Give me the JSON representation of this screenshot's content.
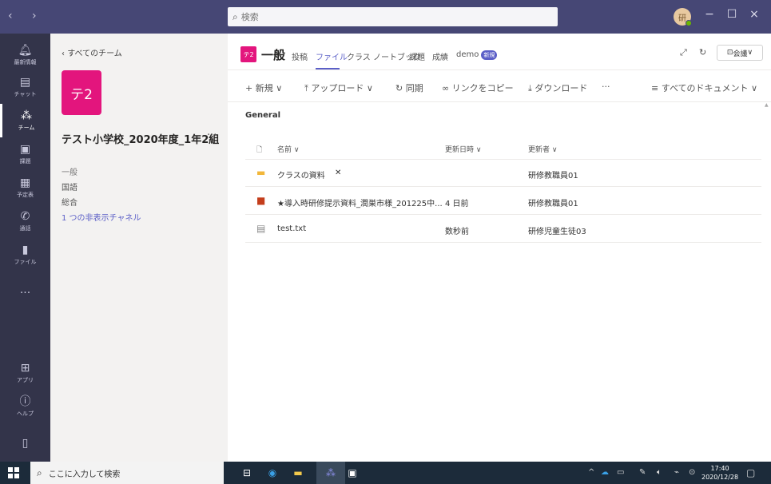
{
  "titlebar": {
    "search_placeholder": "検索",
    "avatar_initial": "研",
    "minimize": "−",
    "maximize": "☐",
    "close": "×"
  },
  "appbar": {
    "items": [
      {
        "label": "最新情報",
        "icon": "bell-icon"
      },
      {
        "label": "チャット",
        "icon": "chat-icon"
      },
      {
        "label": "チーム",
        "icon": "teams-icon"
      },
      {
        "label": "課題",
        "icon": "assignments-icon"
      },
      {
        "label": "予定表",
        "icon": "calendar-icon"
      },
      {
        "label": "通話",
        "icon": "phone-icon"
      },
      {
        "label": "ファイル",
        "icon": "file-icon"
      },
      {
        "label": "",
        "icon": "more-icon"
      },
      {
        "label": "アプリ",
        "icon": "apps-icon"
      },
      {
        "label": "ヘルプ",
        "icon": "help-icon"
      }
    ]
  },
  "teampanel": {
    "back_label": "すべてのチーム",
    "team_avatar": "テ2",
    "team_name": "テスト小学校_2020年度_1年2組",
    "more": "···",
    "channels": [
      "一般",
      "国語",
      "総合"
    ],
    "hidden_channels": "1 つの非表示チャネル"
  },
  "header": {
    "avatar": "テ2",
    "title": "一般",
    "tabs": [
      "投稿",
      "ファイル",
      "クラス ノートブック",
      "課題",
      "成績",
      "demo"
    ],
    "active_tab": "ファイル",
    "new_badge": "新規",
    "meet_label": "会議"
  },
  "toolbar": {
    "new": "+ 新規 ∨",
    "upload": "⤒ アップロード ∨",
    "sync": "同期",
    "copy_link": "リンクをコピー",
    "download": "⤓ ダウンロード",
    "more": "···",
    "all_docs": "≡ すべてのドキュメント ∨"
  },
  "files": {
    "section": "General",
    "columns": {
      "name": "名前 ∨",
      "modified": "更新日時 ∨",
      "modified_by": "更新者 ∨"
    },
    "rows": [
      {
        "name": "クラスの資料",
        "modified": "",
        "modified_by": "研修教職員01",
        "type": "folder"
      },
      {
        "name": "★導入時研修提示資料_潤巣市様_201225中...",
        "modified": "4 日前",
        "modified_by": "研修教職員01",
        "type": "pdf"
      },
      {
        "name": "test.txt",
        "modified": "数秒前",
        "modified_by": "研修児童生徒03",
        "type": "txt"
      }
    ]
  },
  "taskbar": {
    "search_placeholder": "ここに入力して検索",
    "time": "17:40",
    "date": "2020/12/28"
  }
}
